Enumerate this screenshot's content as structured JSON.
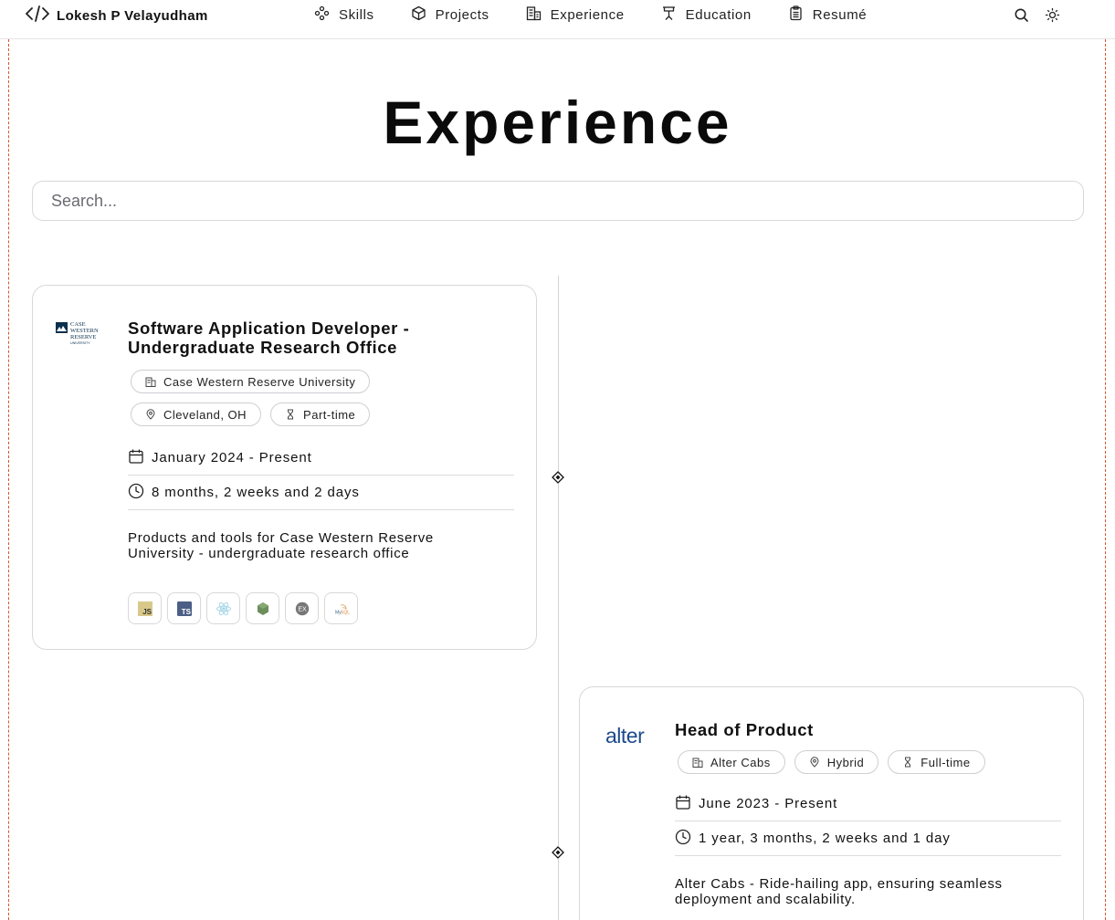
{
  "brand": {
    "name": "Lokesh P Velayudham",
    "icon": "code-brackets-icon"
  },
  "nav": {
    "items": [
      {
        "label": "Skills",
        "icon": "skills-icon"
      },
      {
        "label": "Projects",
        "icon": "cube-icon"
      },
      {
        "label": "Experience",
        "icon": "building-icon"
      },
      {
        "label": "Education",
        "icon": "podium-icon"
      },
      {
        "label": "Resumé",
        "icon": "clipboard-icon"
      }
    ],
    "tools": [
      "search-icon",
      "sun-icon"
    ]
  },
  "page": {
    "title": "Experience"
  },
  "search": {
    "placeholder": "Search..."
  },
  "experiences": [
    {
      "logo_text": [
        "CASE",
        "WESTERN",
        "RESERVE",
        "UNIVERSITY"
      ],
      "role": "Software Application Developer - Undergraduate Research Office",
      "company": "Case Western Reserve University",
      "location": "Cleveland, OH",
      "type": "Part-time",
      "dates": "January 2024 - Present",
      "duration": "8 months, 2 weeks and 2 days",
      "description": "Products and tools for Case Western Reserve University - undergraduate research office",
      "tech": [
        "JS",
        "TS",
        "react-icon",
        "node-icon",
        "EX",
        "mysql-icon"
      ],
      "colors": {
        "logo": "#0a304e"
      }
    },
    {
      "logo_text": "alter",
      "role": "Head of Product",
      "company": "Alter Cabs",
      "location": "Hybrid",
      "type": "Full-time",
      "dates": "June 2023 - Present",
      "duration": "1 year, 3 months, 2 weeks and 1 day",
      "description": "Alter Cabs - Ride-hailing app, ensuring seamless deployment and scalability.",
      "colors": {
        "logo": "#1c4a8c"
      }
    }
  ],
  "colors": {
    "frame": "#d9532c",
    "border": "#d8d8dc"
  }
}
